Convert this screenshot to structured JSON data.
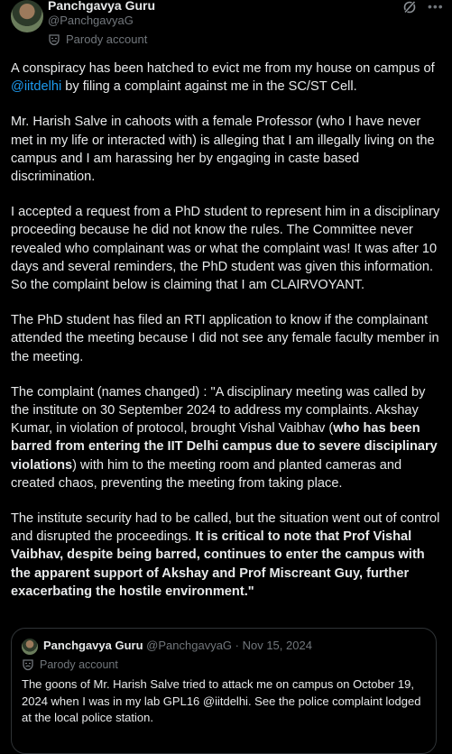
{
  "author": {
    "display_name": "Panchgavya Guru",
    "handle": "@PanchgavyaG",
    "badge": "Parody account"
  },
  "tweet": {
    "p1_a": "A conspiracy has been hatched to evict me from my house on campus of ",
    "p1_mention": "@iitdelhi",
    "p1_b": " by filing a complaint against me in the SC/ST Cell.",
    "p2": "Mr. Harish Salve in cahoots with a female Professor (who I have never met in my life or interacted with) is alleging that I am illegally living on the campus and I am harassing her by engaging in caste based discrimination.",
    "p3": "I accepted a request from a PhD student to represent him in a disciplinary proceeding because he did not know the rules. The Committee never revealed who complainant was or what the complaint was! It was after 10 days and several reminders, the PhD student was given this information. So the complaint below is claiming that I am CLAIRVOYANT.",
    "p4": "The PhD student has filed an RTI application to know if the complainant attended the meeting because I did not see any female faculty member in the meeting.",
    "p5_a": "The complaint (names changed) : \"A disciplinary meeting was called by the institute on 30 September 2024  to address my complaints. Akshay Kumar, in violation of protocol, brought Vishal Vaibhav (",
    "p5_bold": "who has been barred from entering the IIT Delhi  campus due to severe disciplinary violations",
    "p5_b": ") with him to the meeting  room and planted cameras and created chaos, preventing the meeting from  taking place.",
    "p6_a": "The institute security had to be called, but the situation  went out of control and disrupted the proceedings. ",
    "p6_bold": "It is critical to note that Prof Vishal Vaibhav, despite being barred, continues to enter  the campus with the apparent support of Akshay and Prof Miscreant Guy,  further exacerbating the hostile environment.\""
  },
  "quote": {
    "display_name": "Panchgavya Guru",
    "handle": "@PanchgavyaG",
    "separator": " · ",
    "date": "Nov 15, 2024",
    "badge": "Parody account",
    "text": "The goons of Mr. Harish Salve tried to attack me on campus on October 19, 2024 when I was in my lab GPL16 @iitdelhi. See the police complaint lodged at the local police station."
  },
  "icons": {
    "mask": "parody-mask-icon",
    "grok": "grok-icon",
    "more": "more-icon"
  },
  "colors": {
    "background": "#000000",
    "text": "#e7e9ea",
    "secondary": "#71767b",
    "link": "#1d9bf0",
    "border": "#2f3336"
  }
}
